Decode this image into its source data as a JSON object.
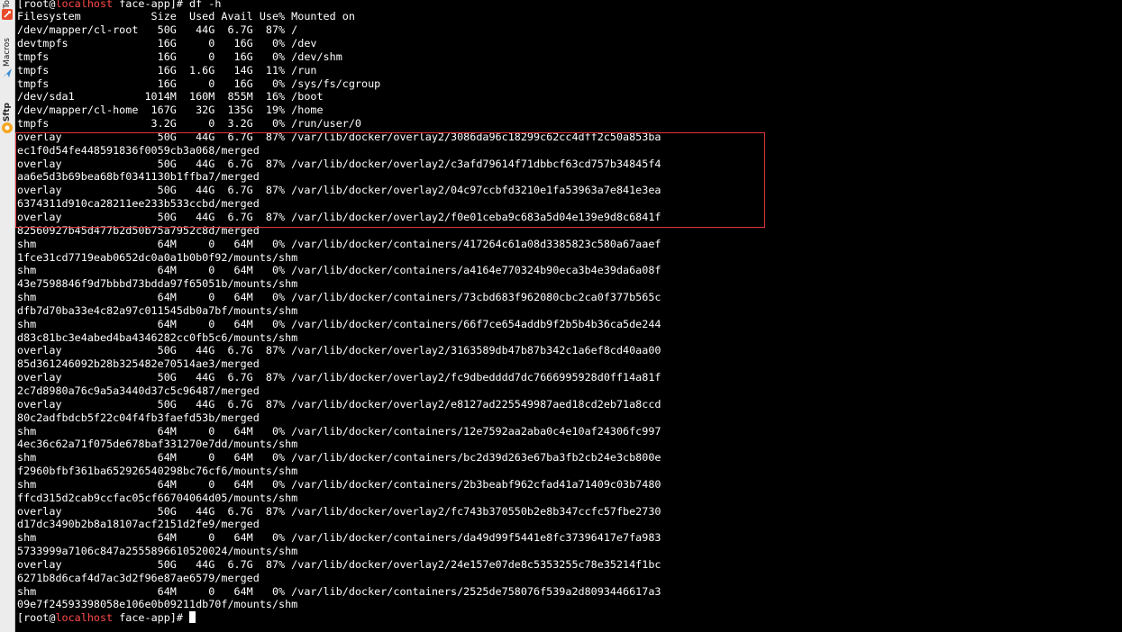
{
  "side_panel": {
    "tabs": [
      {
        "label": "To",
        "icon": "tools-icon"
      },
      {
        "label": "Macros",
        "icon": "macro-icon"
      },
      {
        "label": "Sftp",
        "icon": "sftp-icon"
      }
    ]
  },
  "terminal": {
    "prompt_user": "root",
    "prompt_host": "localhost",
    "prompt_dir": "face-app",
    "command": "df -h",
    "lines": [
      "Filesystem           Size  Used Avail Use% Mounted on",
      "/dev/mapper/cl-root   50G   44G  6.7G  87% /",
      "devtmpfs              16G     0   16G   0% /dev",
      "tmpfs                 16G     0   16G   0% /dev/shm",
      "tmpfs                 16G  1.6G   14G  11% /run",
      "tmpfs                 16G     0   16G   0% /sys/fs/cgroup",
      "/dev/sda1           1014M  160M  855M  16% /boot",
      "/dev/mapper/cl-home  167G   32G  135G  19% /home",
      "tmpfs                3.2G     0  3.2G   0% /run/user/0",
      "overlay               50G   44G  6.7G  87% /var/lib/docker/overlay2/3086da96c18299c62cc4dff2c50a853ba",
      "ec1f0d54fe448591836f0059cb3a068/merged",
      "overlay               50G   44G  6.7G  87% /var/lib/docker/overlay2/c3afd79614f71dbbcf63cd757b34845f4",
      "aa6e5d3b69bea68bf0341130b1ffba7/merged",
      "overlay               50G   44G  6.7G  87% /var/lib/docker/overlay2/04c97ccbfd3210e1fa53963a7e841e3ea",
      "6374311d910ca28211ee233b533ccbd/merged",
      "overlay               50G   44G  6.7G  87% /var/lib/docker/overlay2/f0e01ceba9c683a5d04e139e9d8c6841f",
      "82560927b45d477b2d50b75a7952c8d/merged",
      "shm                   64M     0   64M   0% /var/lib/docker/containers/417264c61a08d3385823c580a67aaef",
      "1fce31cd7719eab0652dc0a0a1b0b0f92/mounts/shm",
      "shm                   64M     0   64M   0% /var/lib/docker/containers/a4164e770324b90eca3b4e39da6a08f",
      "43e7598846f9d7bbbd73bdda97f65051b/mounts/shm",
      "shm                   64M     0   64M   0% /var/lib/docker/containers/73cbd683f962080cbc2ca0f377b565c",
      "dfb7d70ba33e4c82a97c011545db0a7bf/mounts/shm",
      "shm                   64M     0   64M   0% /var/lib/docker/containers/66f7ce654addb9f2b5b4b36ca5de244",
      "d83c81bc3e4abed4ba4346282cc0fb5c6/mounts/shm",
      "overlay               50G   44G  6.7G  87% /var/lib/docker/overlay2/3163589db47b87b342c1a6ef8cd40aa00",
      "85d361246092b28b325482e70514ae3/merged",
      "overlay               50G   44G  6.7G  87% /var/lib/docker/overlay2/fc9dbedddd7dc7666995928d0ff14a81f",
      "2c7d8980a76c9a5a3440d37c5c96487/merged",
      "overlay               50G   44G  6.7G  87% /var/lib/docker/overlay2/e8127ad225549987aed18cd2eb71a8ccd",
      "80c2adfbdcb5f22c04f4fb3faefd53b/merged",
      "shm                   64M     0   64M   0% /var/lib/docker/containers/12e7592aa2aba0c4e10af24306fc997",
      "4ec36c62a71f075de678baf331270e7dd/mounts/shm",
      "shm                   64M     0   64M   0% /var/lib/docker/containers/bc2d39d263e67ba3fb2cb24e3cb800e",
      "f2960bfbf361ba652926540298bc76cf6/mounts/shm",
      "shm                   64M     0   64M   0% /var/lib/docker/containers/2b3beabf962cfad41a71409c03b7480",
      "ffcd315d2cab9ccfac05cf66704064d05/mounts/shm",
      "overlay               50G   44G  6.7G  87% /var/lib/docker/overlay2/fc743b370550b2e8b347ccfc57fbe2730",
      "d17dc3490b2b8a18107acf2151d2fe9/merged",
      "shm                   64M     0   64M   0% /var/lib/docker/containers/da49d99f5441e8fc37396417e7fa983",
      "5733999a7106c847a2555896610520024/mounts/shm",
      "overlay               50G   44G  6.7G  87% /var/lib/docker/overlay2/24e157e07de8c5353255c78e35214f1bc",
      "6271b8d6caf4d7ac3d2f96e87ae6579/merged",
      "shm                   64M     0   64M   0% /var/lib/docker/containers/2525de758076f539a2d8093446617a3",
      "09e7f24593398058e106e0b09211db70f/mounts/shm"
    ],
    "highlight_color": "#e0363c"
  }
}
